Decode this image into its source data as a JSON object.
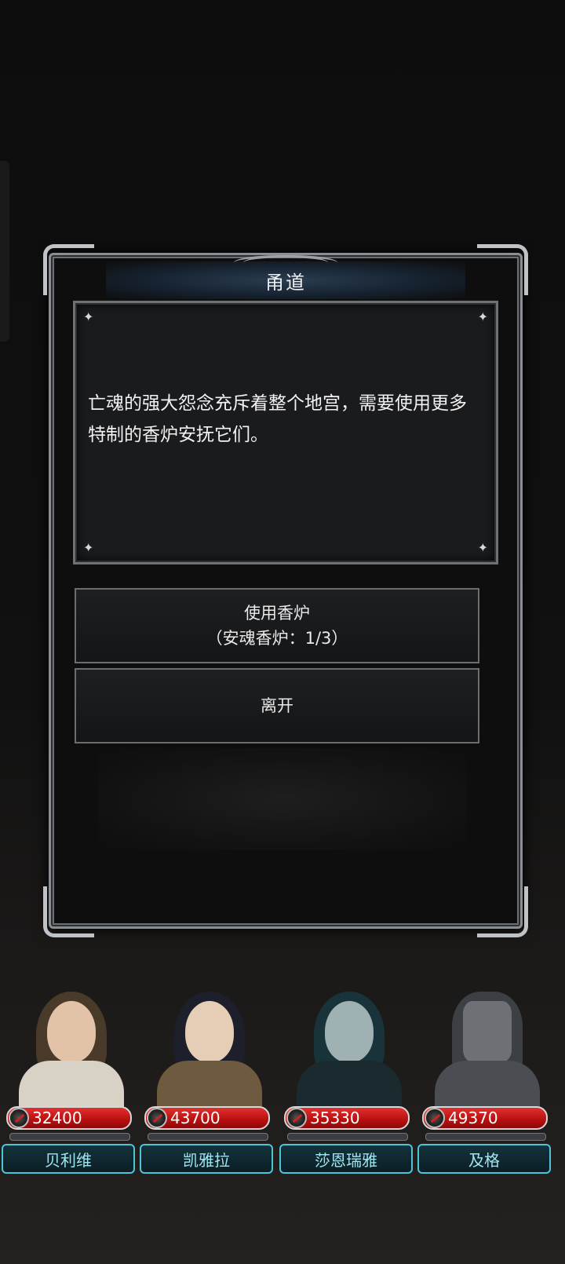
{
  "dialog": {
    "title": "甬道",
    "story_text": "亡魂的强大怨念充斥着整个地宫，需要使用更多特制的香炉安抚它们。",
    "choices": [
      {
        "line1": "使用香炉",
        "line2": "（安魂香炉：1/3）"
      },
      {
        "line1": "离开",
        "line2": ""
      }
    ]
  },
  "party": [
    {
      "name": "贝利维",
      "hp": "32400",
      "theme": {
        "hair": "#4a3a2a",
        "skin": "#e2c3a8",
        "outfit": "#d8d2c6"
      }
    },
    {
      "name": "凯雅拉",
      "hp": "43700",
      "theme": {
        "hair": "#1d1f2a",
        "skin": "#e6cdb6",
        "outfit": "#6e5a3e"
      }
    },
    {
      "name": "莎恩瑞雅",
      "hp": "35330",
      "theme": {
        "hair": "#18343a",
        "skin": "#9fb1b3",
        "outfit": "#1a2a2e"
      }
    },
    {
      "name": "及格",
      "hp": "49370",
      "theme": {
        "hair": "#3c3f44",
        "skin": "#6d7075",
        "outfit": "#4a4d52"
      }
    }
  ],
  "colors": {
    "hp_bar": "#c41414",
    "name_border": "#4cc6d6",
    "frame": "#8a8d92"
  }
}
